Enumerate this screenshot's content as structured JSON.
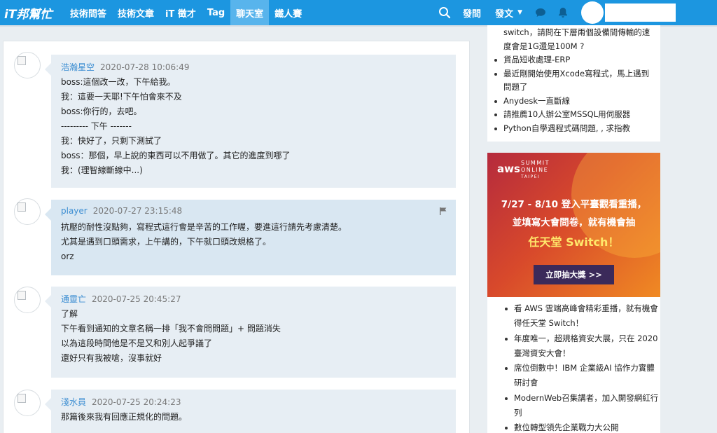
{
  "nav": {
    "logo": "iT邦幫忙",
    "items": [
      "技術問答",
      "技術文章",
      "iT 徵才",
      "Tag",
      "聊天室",
      "鐵人賽"
    ],
    "active_index": 4,
    "ask_label": "發問",
    "post_label": "發文",
    "accent": "#1c96e0"
  },
  "messages": [
    {
      "author": "浩瀚星空",
      "time": "2020-07-28 10:06:49",
      "lines": [
        "boss:這個改一改，下午給我。",
        "我：這要一天耶!下午怕會來不及",
        "boss:你行的，去吧。",
        "--------- 下午 -------",
        "我：快好了，只剩下測試了",
        "boss：那個，早上說的東西可以不用做了。其它的進度到哪了",
        "我：(理智線斷線中...)"
      ]
    },
    {
      "author": "player",
      "time": "2020-07-27 23:15:48",
      "lines": [
        "抗壓的耐性沒點夠，寫程式這行會是辛苦的工作喔，要進這行請先考慮清楚。",
        "尤其是遇到口頭需求，上午講的，下午就口頭改規格了。",
        "orz"
      ]
    },
    {
      "author": "通靈亡",
      "time": "2020-07-25 20:45:27",
      "lines": [
        "了解",
        "下午看到通知的文章名稱一排「我不會問問題」+ 問題消失",
        "以為這段時間他是不是又和別人起爭議了",
        "還好只有我被嗆，沒事就好"
      ]
    },
    {
      "author": "淺水員",
      "time": "2020-07-25 20:24:23",
      "lines": [
        "那篇後來我有回應正規化的問題。"
      ]
    }
  ],
  "sidebar": {
    "top_items": [
      {
        "text": "switch，請問在下層兩個設備間傳輸的速",
        "bullet": false
      },
      {
        "text": "度會是1G還是100M ?",
        "bullet": false
      },
      {
        "text": "貨品短收處理-ERP",
        "bullet": true
      },
      {
        "text": "最近剛開始使用Xcode寫程式，馬上遇到",
        "bullet": true
      },
      {
        "text": "問題了",
        "bullet": false
      },
      {
        "text": "Anydesk一直斷線",
        "bullet": true
      },
      {
        "text": "請推薦10人辦公室MSSQL用伺服器",
        "bullet": true
      },
      {
        "text": "Python自學遇程式碼問題, , 求指教",
        "bullet": true
      }
    ],
    "ad": {
      "logo": "aws",
      "summit": [
        "SUMMIT",
        "ONLINE",
        "TAIPEI"
      ],
      "line1": "7/27 - 8/10 登入平臺觀看重播，",
      "line2": "並填寫大會問卷，就有機會抽",
      "line3": "任天堂 Switch！",
      "button": "立即抽大獎 >>"
    },
    "bottom_items": [
      {
        "text": "看 AWS 雲端高峰會精彩重播，就有機會",
        "bullet": true
      },
      {
        "text": "得任天堂 Switch！",
        "bullet": false
      },
      {
        "text": "年度唯一，超規格資安大展，只在 2020",
        "bullet": true
      },
      {
        "text": "臺灣資安大會！",
        "bullet": false
      },
      {
        "text": "席位倒數中！IBM 企業級AI 協作力實體",
        "bullet": true
      },
      {
        "text": "研討會",
        "bullet": false
      },
      {
        "text": "ModernWeb召集講者，加入開發網紅行",
        "bullet": true
      },
      {
        "text": "列",
        "bullet": false
      },
      {
        "text": "數位轉型領先企業戰力大公開",
        "bullet": true
      }
    ]
  }
}
